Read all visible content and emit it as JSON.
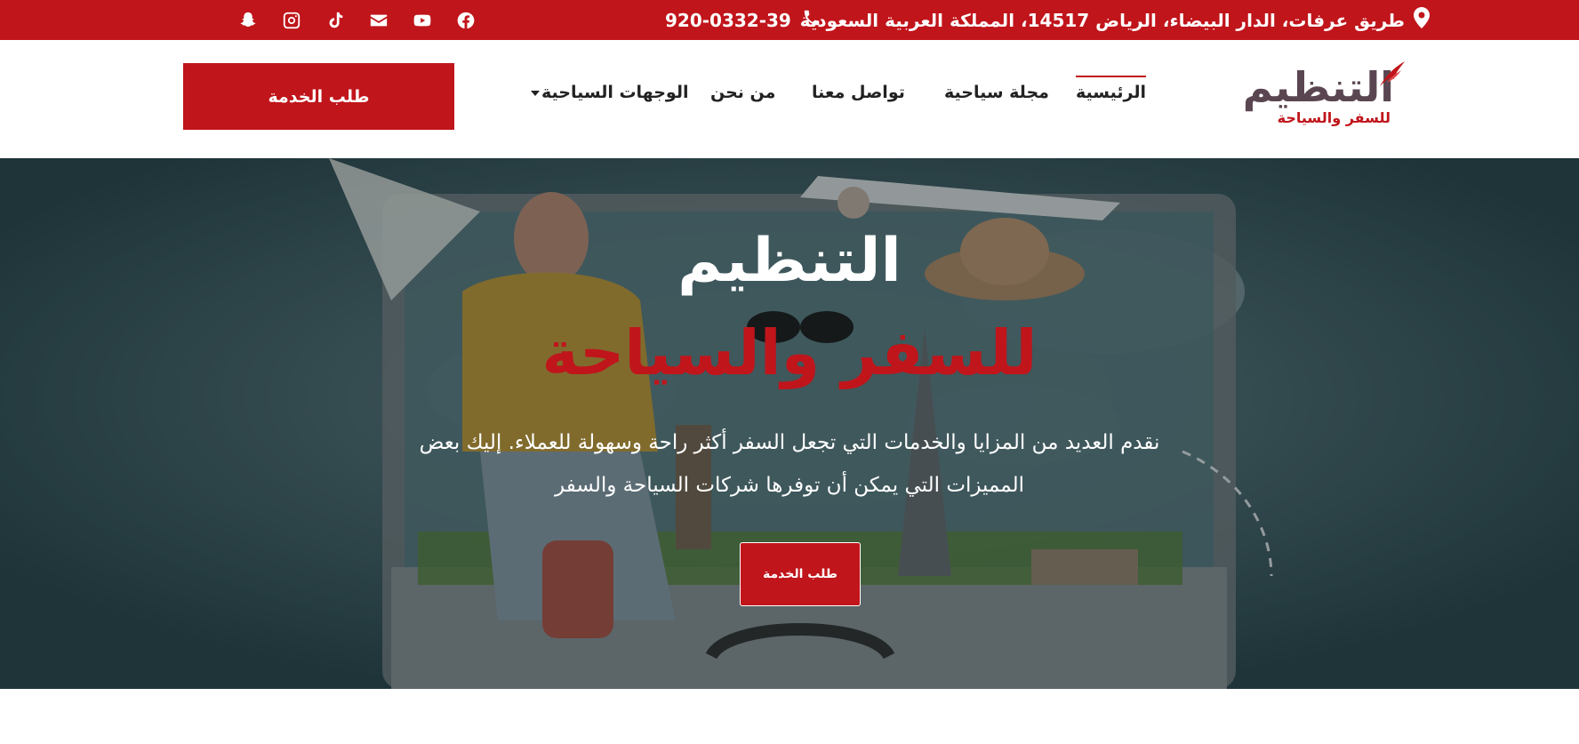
{
  "topbar": {
    "address": "طريق عرفات، الدار البيضاء، الرياض 14517، المملكة العربية السعودية",
    "phone": "920-0332-39",
    "social_icons": [
      "facebook-icon",
      "youtube-icon",
      "email-icon",
      "tiktok-icon",
      "instagram-icon",
      "snapchat-icon"
    ]
  },
  "header": {
    "logo_main": "التنظيم",
    "logo_sub": "للسفر والسياحة",
    "nav": [
      {
        "label": "الرئيسية",
        "active": true
      },
      {
        "label": "مجلة سياحية"
      },
      {
        "label": "تواصل معنا"
      },
      {
        "label": "من نحن"
      },
      {
        "label": "الوجهات السياحية",
        "dropdown": true
      }
    ],
    "cta_label": "طلب الخدمة"
  },
  "hero": {
    "title": "التنظيم",
    "subtitle": "للسفر والسياحة",
    "description": "نقدم العديد من المزايا والخدمات التي تجعل السفر أكثر راحة وسهولة للعملاء. إليك بعض المميزات التي يمكن أن توفرها شركات السياحة والسفر",
    "cta_label": "طلب الخدمة"
  },
  "colors": {
    "brand_red": "#c0151b",
    "logo_plum": "#5a4651",
    "hero_bg": "#2b4a50"
  }
}
